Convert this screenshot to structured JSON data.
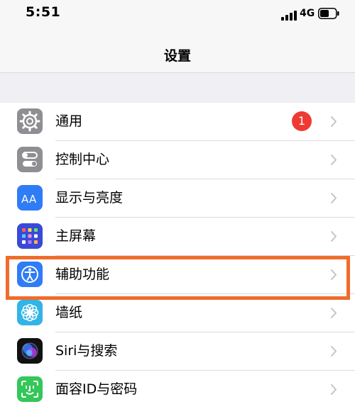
{
  "status_bar": {
    "time": "5:51",
    "network": "4G"
  },
  "nav": {
    "title": "设置"
  },
  "settings": {
    "items": [
      {
        "label": "通用",
        "icon": "gear-icon",
        "badge": "1"
      },
      {
        "label": "控制中心",
        "icon": "toggle-switches-icon"
      },
      {
        "label": "显示与亮度",
        "icon": "text-size-aa-icon"
      },
      {
        "label": "主屏幕",
        "icon": "home-screen-grid-icon"
      },
      {
        "label": "辅助功能",
        "icon": "accessibility-person-icon",
        "highlighted": true
      },
      {
        "label": "墙纸",
        "icon": "flower-icon"
      },
      {
        "label": "Siri与搜索",
        "icon": "siri-orb-icon"
      },
      {
        "label": "面容ID与密码",
        "icon": "face-id-icon"
      }
    ]
  },
  "colors": {
    "highlight": "#ef6c2b",
    "badge": "#ee3a33",
    "gray_icon": "#8e8e93",
    "blue_icon": "#2f7cf6"
  }
}
